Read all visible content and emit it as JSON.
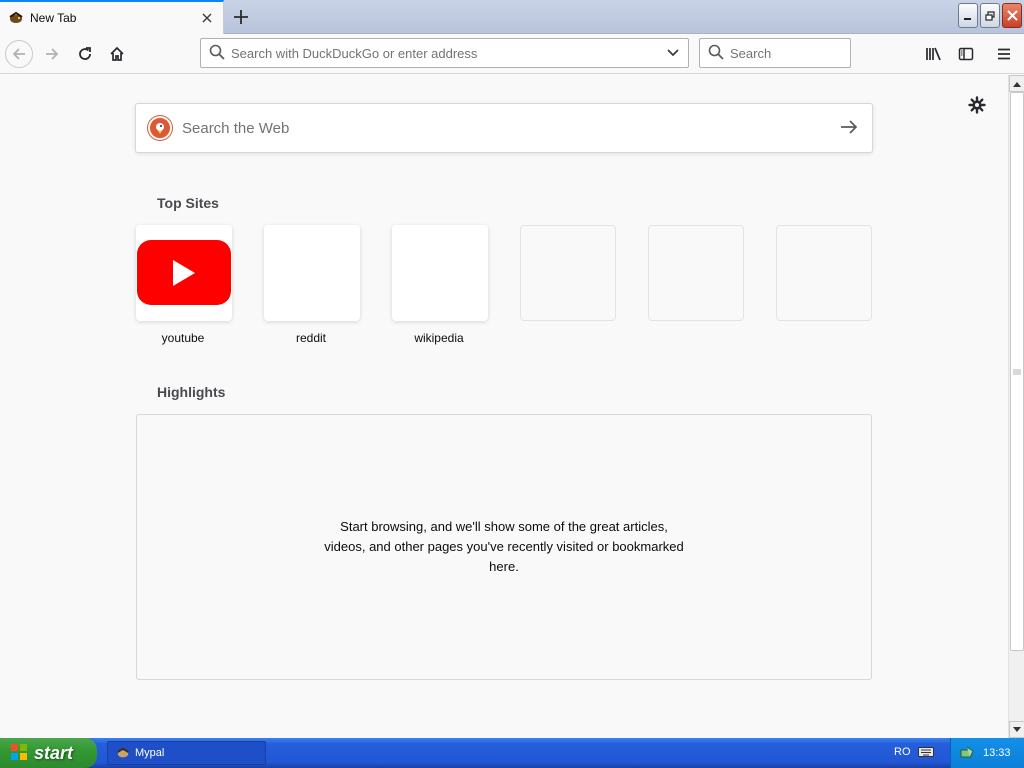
{
  "window": {
    "tab_title": "New Tab",
    "controls": [
      "minimize-icon",
      "restore-icon",
      "close-icon"
    ]
  },
  "navbar": {
    "url_placeholder": "Search with DuckDuckGo or enter address",
    "search_placeholder": "Search",
    "icons": [
      "back-icon",
      "forward-icon",
      "reload-icon",
      "home-icon",
      "library-icon",
      "sidebar-icon",
      "menu-icon"
    ]
  },
  "content": {
    "web_search_placeholder": "Search the Web",
    "top_sites_title": "Top Sites",
    "top_sites": [
      {
        "label": "youtube",
        "filled": true
      },
      {
        "label": "reddit",
        "filled": true
      },
      {
        "label": "wikipedia",
        "filled": true
      },
      {
        "label": "",
        "filled": false
      },
      {
        "label": "",
        "filled": false
      },
      {
        "label": "",
        "filled": false
      }
    ],
    "highlights_title": "Highlights",
    "highlights_empty_message": "Start browsing, and we'll show some of the great articles, videos, and other pages you've recently visited or bookmarked here."
  },
  "taskbar": {
    "start_label": "start",
    "task_label": "Mypal",
    "language": "RO",
    "clock": "13:33"
  },
  "colors": {
    "accent": "#0a84ff",
    "youtube_red": "#ff0000",
    "ddg_orange": "#de5833",
    "taskbar_blue": "#245edb",
    "start_green": "#339933"
  }
}
